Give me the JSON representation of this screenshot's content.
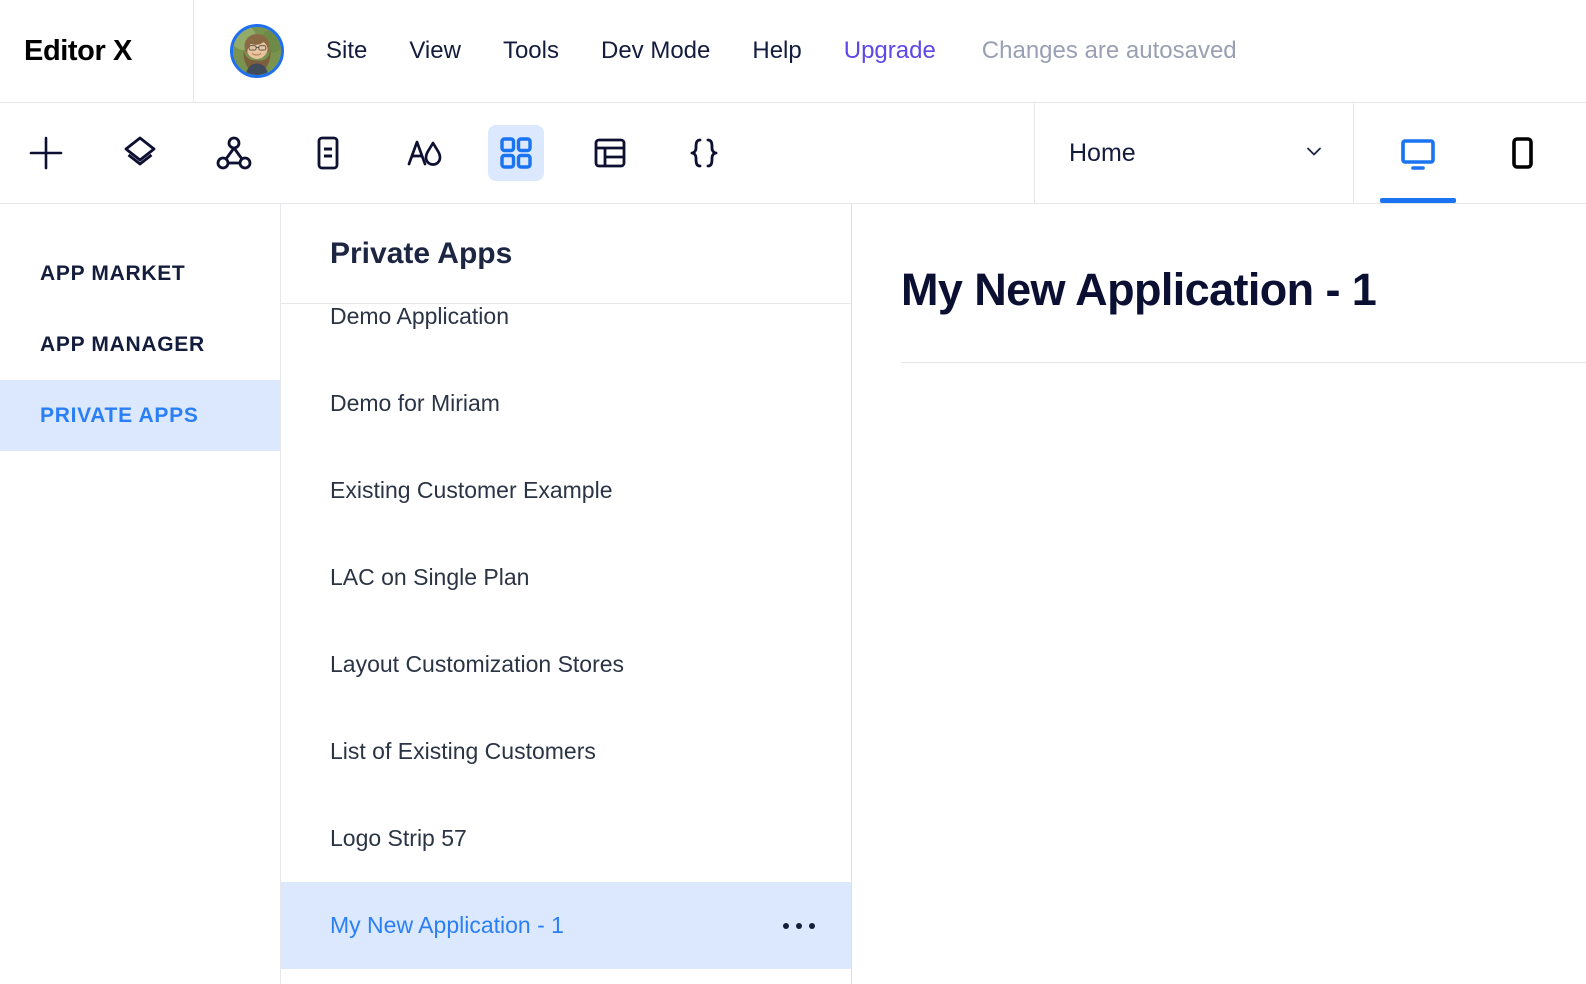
{
  "header": {
    "logo": "Editor X",
    "logo_mark": "X",
    "avatar_name": "user-avatar",
    "menu": [
      {
        "label": "Site",
        "style": "default"
      },
      {
        "label": "View",
        "style": "default"
      },
      {
        "label": "Tools",
        "style": "default"
      },
      {
        "label": "Dev Mode",
        "style": "default"
      },
      {
        "label": "Help",
        "style": "default"
      }
    ],
    "upgrade_label": "Upgrade",
    "autosave_label": "Changes are autosaved"
  },
  "toolbar": {
    "tools": [
      {
        "name": "add-icon",
        "label": "Add"
      },
      {
        "name": "layers-icon",
        "label": "Layers"
      },
      {
        "name": "interactions-icon",
        "label": "Interactions"
      },
      {
        "name": "pages-icon",
        "label": "Pages"
      },
      {
        "name": "theme-icon",
        "label": "Theme"
      },
      {
        "name": "apps-grid-icon",
        "label": "Apps",
        "active": true
      },
      {
        "name": "database-icon",
        "label": "CMS"
      },
      {
        "name": "code-icon",
        "label": "Dev Mode Code"
      }
    ],
    "page_selector": {
      "value": "Home",
      "chevron": "chevron-down-icon"
    },
    "viewports": [
      {
        "name": "desktop-view-icon",
        "label": "Desktop",
        "active": true
      },
      {
        "name": "mobile-view-icon",
        "label": "Mobile",
        "active": false
      }
    ]
  },
  "sidebar": {
    "items": [
      {
        "label": "APP MARKET",
        "active": false
      },
      {
        "label": "APP MANAGER",
        "active": false
      },
      {
        "label": "PRIVATE APPS",
        "active": true
      }
    ]
  },
  "private_apps": {
    "title": "Private Apps",
    "items": [
      {
        "label": "Demo Application",
        "selected": false
      },
      {
        "label": "Demo for Miriam",
        "selected": false
      },
      {
        "label": "Existing Customer Example",
        "selected": false
      },
      {
        "label": "LAC on Single Plan",
        "selected": false
      },
      {
        "label": "Layout Customization Stores",
        "selected": false
      },
      {
        "label": "List of Existing Customers",
        "selected": false
      },
      {
        "label": "Logo Strip 57",
        "selected": false
      },
      {
        "label": "My New Application - 1",
        "selected": true,
        "menu": "more-options-icon"
      }
    ]
  },
  "detail": {
    "title": "My New Application - 1"
  },
  "colors": {
    "accent_blue": "#2b7ff6",
    "highlight_bg": "#dbe8fe",
    "upgrade_purple": "#5e48e8",
    "text_dark": "#131c3d",
    "muted": "#9aa0b4",
    "border": "#e5e7eb"
  }
}
